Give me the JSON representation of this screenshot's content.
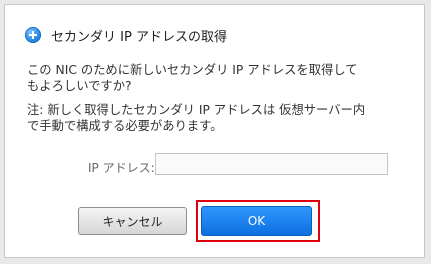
{
  "dialog": {
    "title": "セカンダリ IP アドレスの取得",
    "message_line1": "この NIC のために新しいセカンダリ IP アドレスを取得して",
    "message_line2": "もよろしいですか?",
    "note_line1": "注: 新しく取得したセカンダリ IP アドレスは 仮想サーバー内",
    "note_line2": "で手動で構成する必要があります。",
    "ip_label": "IP アドレス:",
    "ip_value": "",
    "cancel_label": "キャンセル",
    "ok_label": "OK"
  },
  "icons": {
    "title_icon": "plus-circle-icon"
  },
  "colors": {
    "ok_button": "#1279f0",
    "highlight_outline": "#e0000d"
  }
}
